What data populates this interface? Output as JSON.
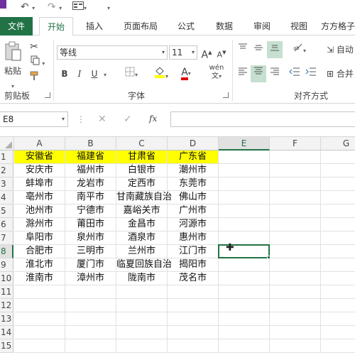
{
  "ribbon_tabs": {
    "file": "文件",
    "home": "开始",
    "insert": "插入",
    "layout": "页面布局",
    "formulas": "公式",
    "data": "数据",
    "review": "审阅",
    "view": "视图",
    "square": "方方格子"
  },
  "clipboard": {
    "paste": "粘贴",
    "group": "剪贴板"
  },
  "font": {
    "name": "等线",
    "size": "11",
    "group": "字体",
    "bold": "B",
    "italic": "I",
    "underline": "U",
    "grow": "A",
    "shrink": "A",
    "phonetic": "wén",
    "font_color_letter": "A"
  },
  "alignment": {
    "group": "对齐方式",
    "wrap": "自动",
    "merge": "合并"
  },
  "formula_bar": {
    "name_box": "E8",
    "fx": "fx",
    "cancel": "✕",
    "enter": "✓",
    "value": ""
  },
  "columns": [
    "A",
    "B",
    "C",
    "D",
    "E",
    "F",
    "G"
  ],
  "rows": [
    "1",
    "2",
    "3",
    "4",
    "5",
    "6",
    "7",
    "8",
    "9",
    "10",
    "11",
    "12",
    "13",
    "14",
    "15"
  ],
  "active_cell": "E8",
  "highlight_color": "#ffff00",
  "accent_color": "#217346",
  "cells": {
    "A1": "安徽省",
    "B1": "福建省",
    "C1": "甘肃省",
    "D1": "广东省",
    "A2": "安庆市",
    "B2": "福州市",
    "C2": "白银市",
    "D2": "潮州市",
    "A3": "蚌埠市",
    "B3": "龙岩市",
    "C3": "定西市",
    "D3": "东莞市",
    "A4": "亳州市",
    "B4": "南平市",
    "C4": "甘南藏族自治",
    "D4": "佛山市",
    "A5": "池州市",
    "B5": "宁德市",
    "C5": "嘉峪关市",
    "D5": "广州市",
    "A6": "滁州市",
    "B6": "莆田市",
    "C6": "金昌市",
    "D6": "河源市",
    "A7": "阜阳市",
    "B7": "泉州市",
    "C7": "酒泉市",
    "D7": "惠州市",
    "A8": "合肥市",
    "B8": "三明市",
    "C8": "兰州市",
    "D8": "江门市",
    "A9": "淮北市",
    "B9": "厦门市",
    "C9": "临夏回族自治",
    "D9": "揭阳市",
    "A10": "淮南市",
    "B10": "漳州市",
    "C10": "陇南市",
    "D10": "茂名市"
  }
}
